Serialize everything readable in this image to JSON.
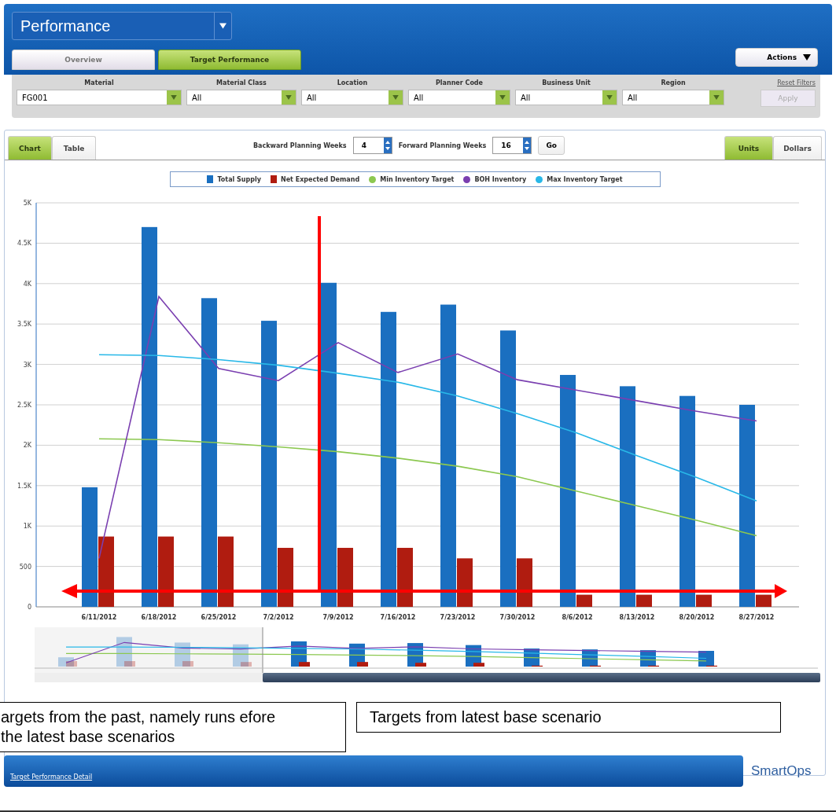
{
  "header": {
    "title": "Performance",
    "tabs": [
      {
        "label": "Overview",
        "selected": false
      },
      {
        "label": "Target Performance",
        "selected": true
      }
    ],
    "actions": "Actions"
  },
  "filters": [
    {
      "label": "Material",
      "value": "FG001"
    },
    {
      "label": "Material Class",
      "value": "All"
    },
    {
      "label": "Location",
      "value": "All"
    },
    {
      "label": "Planner Code",
      "value": "All"
    },
    {
      "label": "Business Unit",
      "value": "All"
    },
    {
      "label": "Region",
      "value": "All"
    }
  ],
  "reset_filters": "Reset Filters",
  "apply": {
    "label": "Apply",
    "disabled": true
  },
  "view_tabs": [
    {
      "label": "Chart",
      "selected": true
    },
    {
      "label": "Table",
      "selected": false
    }
  ],
  "planning": [
    {
      "label": "Backward Planning Weeks",
      "value": "4"
    },
    {
      "label": "Forward Planning Weeks",
      "value": "16"
    }
  ],
  "go": "Go",
  "unit_tabs": [
    {
      "label": "Units",
      "selected": true
    },
    {
      "label": "Dollars",
      "selected": false
    }
  ],
  "chart_data": {
    "type": "bar",
    "categories": [
      "6/11/2012",
      "6/18/2012",
      "6/25/2012",
      "7/2/2012",
      "7/9/2012",
      "7/16/2012",
      "7/23/2012",
      "7/30/2012",
      "8/6/2012",
      "8/13/2012",
      "8/20/2012",
      "8/27/2012"
    ],
    "ylim": [
      0,
      5000
    ],
    "grid": true,
    "yticks": [
      0,
      {
        "value": 500,
        "label": "500"
      },
      {
        "value": 1000,
        "label": "1K"
      },
      {
        "value": 1500,
        "label": "1.5K"
      },
      {
        "value": 2000,
        "label": "2K"
      },
      {
        "value": 2500,
        "label": "2.5K"
      },
      {
        "value": 3000,
        "label": "3K"
      },
      {
        "value": 3500,
        "label": "3.5K"
      },
      {
        "value": 4000,
        "label": "4K"
      },
      {
        "value": 4500,
        "label": "4.5K"
      },
      {
        "value": 5000,
        "label": "5K"
      }
    ],
    "series": [
      {
        "name": "Total Supply",
        "color": "#1a6fc0",
        "type": "bar",
        "values": [
          1480,
          4700,
          3820,
          3540,
          4010,
          3650,
          3740,
          3420,
          2870,
          2730,
          2610,
          2500
        ]
      },
      {
        "name": "Net Expected Demand",
        "color": "#b01c10",
        "type": "bar",
        "values": [
          870,
          870,
          870,
          730,
          730,
          730,
          600,
          600,
          150,
          150,
          150,
          150
        ]
      },
      {
        "name": "Min Inventory Target",
        "color": "#8cc850",
        "type": "line",
        "values": [
          2080,
          2070,
          2030,
          1980,
          1920,
          1840,
          1740,
          1610,
          1430,
          1250,
          1070,
          880
        ]
      },
      {
        "name": "BOH Inventory",
        "color": "#7a3fb0",
        "type": "line",
        "values": [
          600,
          3840,
          2950,
          2800,
          3270,
          2900,
          3130,
          2810,
          2680,
          2550,
          2420,
          2300
        ]
      },
      {
        "name": "Max Inventory Target",
        "color": "#28b8e8",
        "type": "line",
        "values": [
          3120,
          3110,
          3060,
          2990,
          2890,
          2780,
          2610,
          2390,
          2150,
          1870,
          1600,
          1310
        ]
      }
    ]
  },
  "annotations": [
    "argets from the past, namely runs efore the latest base scenarios",
    "Targets from latest base scenario"
  ],
  "footer": {
    "link": "Target Performance Detail",
    "brand": "SmartOps"
  }
}
